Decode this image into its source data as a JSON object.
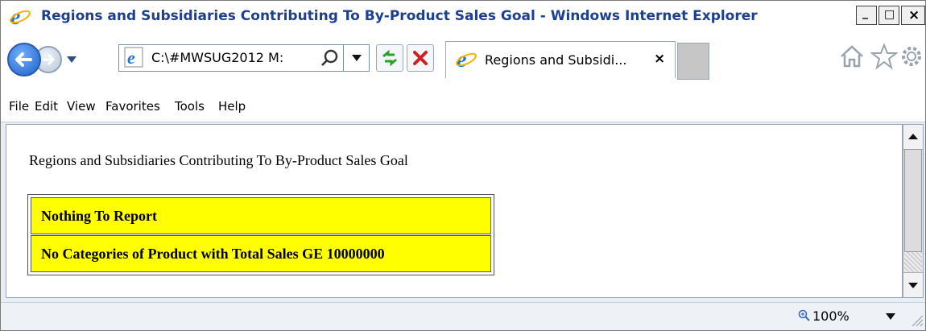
{
  "window": {
    "title": "Regions and Subsidiaries Contributing To By-Product Sales Goal - Windows Internet Explorer",
    "controls": {
      "minimize": "_",
      "maximize": "□",
      "close": "×"
    }
  },
  "address_bar": {
    "url": "C:\\#MWSUG2012 M:"
  },
  "tab": {
    "label": "Regions and Subsidi...",
    "close": "×"
  },
  "menu": {
    "items": [
      "File",
      "Edit",
      "View",
      "Favorites",
      "Tools",
      "Help"
    ]
  },
  "page": {
    "heading": "Regions and Subsidiaries Contributing To By-Product Sales Goal",
    "table_rows": [
      "Nothing To Report",
      "No Categories of Product with Total Sales GE 10000000"
    ],
    "cell_color": "#ffff00"
  },
  "status": {
    "zoom": "100%"
  },
  "icons": {
    "ie": "ie-logo-icon",
    "back": "back-arrow-icon",
    "forward": "forward-arrow-icon",
    "refresh": "refresh-icon",
    "stop": "stop-icon",
    "search": "search-icon",
    "home": "home-icon",
    "favorites": "star-icon",
    "tools": "gear-icon"
  }
}
